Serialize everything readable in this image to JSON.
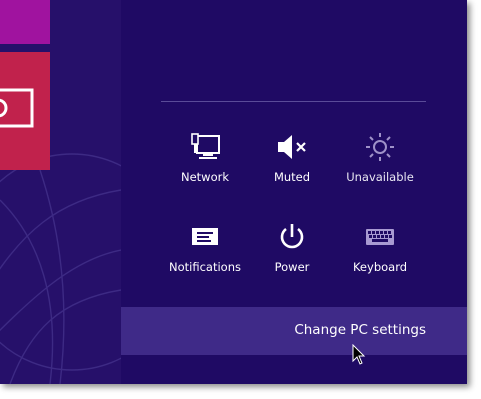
{
  "quick_settings": [
    {
      "label": "Network",
      "icon": "network-icon"
    },
    {
      "label": "Muted",
      "icon": "speaker-muted-icon"
    },
    {
      "label": "Unavailable",
      "icon": "brightness-icon"
    },
    {
      "label": "Notifications",
      "icon": "notifications-icon"
    },
    {
      "label": "Power",
      "icon": "power-icon"
    },
    {
      "label": "Keyboard",
      "icon": "keyboard-icon"
    }
  ],
  "change_pc_settings": "Change PC settings",
  "colors": {
    "charms_background": "#1f0a64",
    "settings_bar": "#3f2a88",
    "tile_purple": "#a0139f",
    "tile_red": "#c1224c",
    "text": "#ffffff"
  }
}
